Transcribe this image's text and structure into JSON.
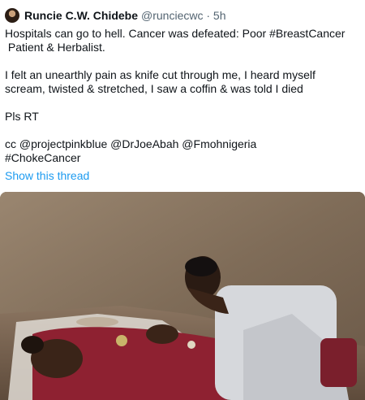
{
  "tweet": {
    "author_name": "Runcie C.W. Chidebe",
    "handle_time": "@runciecwc · 5h",
    "paragraphs": [
      "Hospitals can go to hell. Cancer was defeated: Poor #BreastCancer\n Patient & Herbalist.",
      "I felt an unearthly pain as knife cut through me, I heard myself scream, twisted & stretched, I saw a coffin & was told I died",
      "Pls RT",
      "cc @projectpinkblue @DrJoeAbah @Fmohnigeria\n#ChokeCancer"
    ],
    "show_thread": "Show this thread"
  },
  "colors": {
    "link": "#1d9bf0",
    "text": "#0f1419",
    "secondary_text": "#536471"
  },
  "icons": {
    "avatar": "profile-photo"
  }
}
